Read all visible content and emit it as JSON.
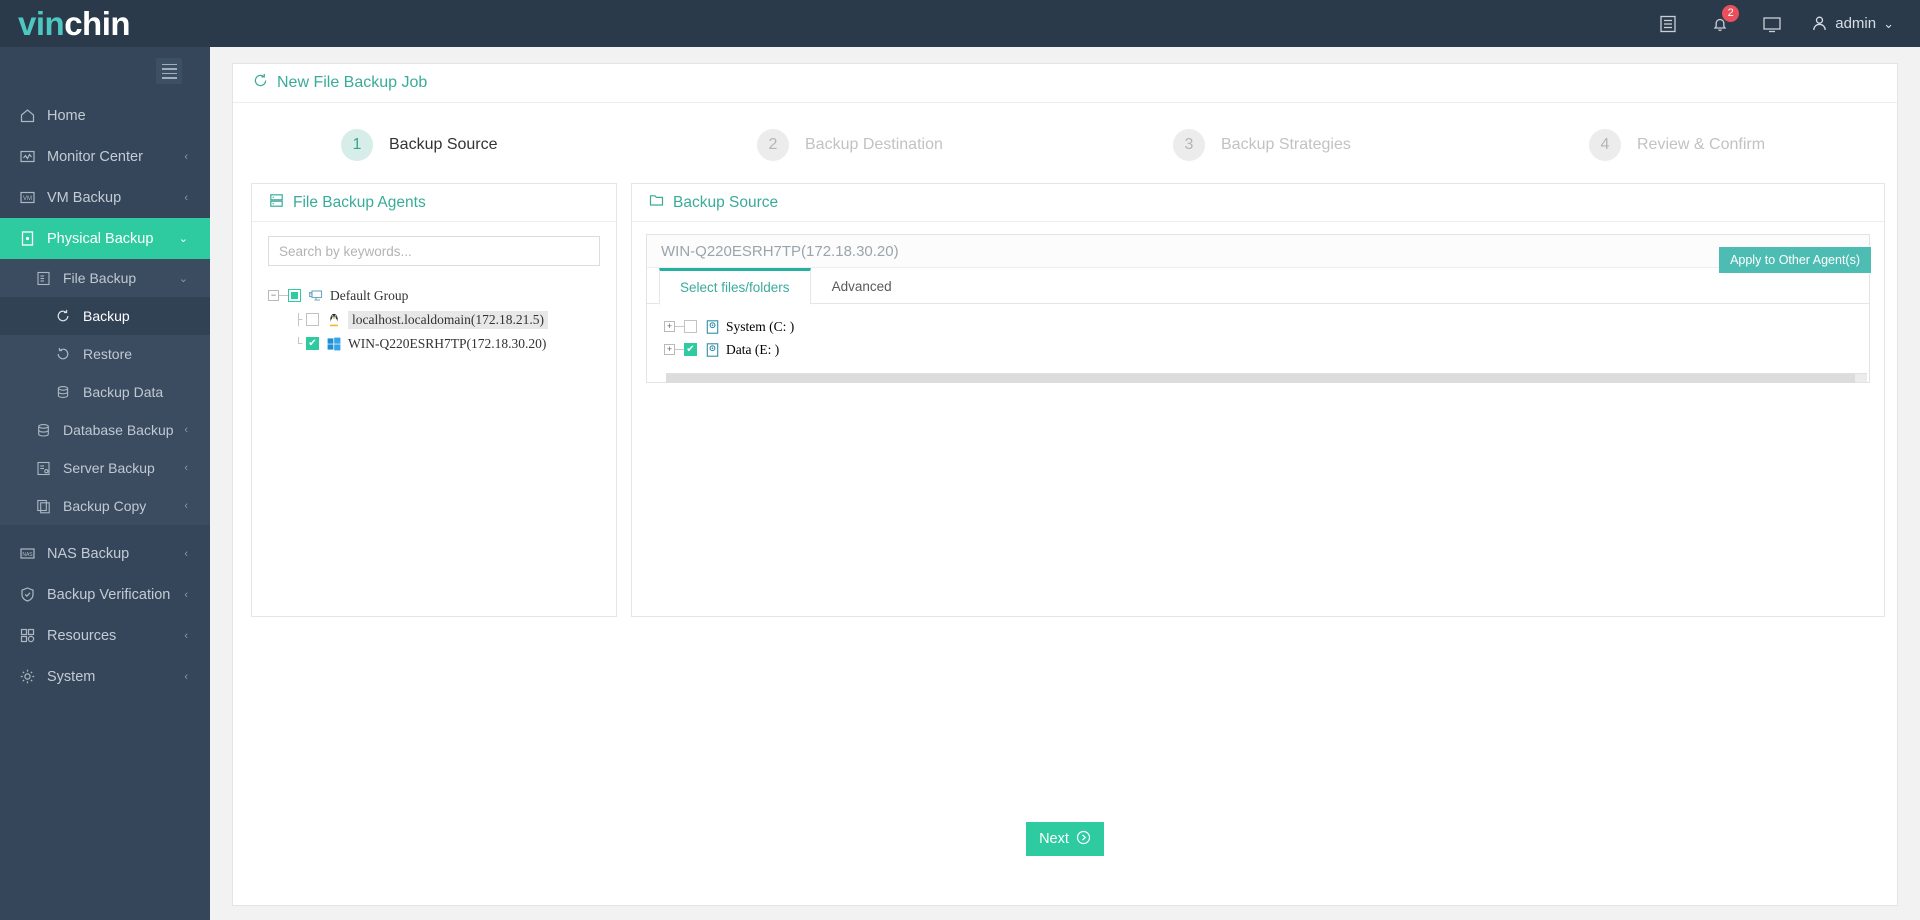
{
  "brand": {
    "part1": "vin",
    "part2": "chin",
    "accent": "#4dc8c0"
  },
  "topbar": {
    "icons": [
      {
        "name": "logs-icon",
        "glyph": "list"
      },
      {
        "name": "notifications-icon",
        "glyph": "bell",
        "badge": "2"
      },
      {
        "name": "console-icon",
        "glyph": "monitor"
      }
    ],
    "user": {
      "label": "admin",
      "caret": "⌄"
    }
  },
  "sidebar": {
    "toggle": "menu-toggle",
    "items": [
      {
        "label": "Home",
        "icon": "home-icon",
        "chevron": "",
        "active": false
      },
      {
        "label": "Monitor Center",
        "icon": "monitor-icon",
        "chevron": "‹",
        "active": false
      },
      {
        "label": "VM Backup",
        "icon": "vm-icon",
        "chevron": "‹",
        "active": false
      },
      {
        "label": "Physical Backup",
        "icon": "server-icon",
        "chevron": "⌄",
        "active": true
      }
    ],
    "sub_items": [
      {
        "label": "File Backup",
        "icon": "file-backup-icon",
        "chevron": "⌄",
        "level": 1,
        "selected": false
      },
      {
        "label": "Backup",
        "icon": "backup-icon",
        "chevron": "",
        "level": 2,
        "selected": true
      },
      {
        "label": "Restore",
        "icon": "restore-icon",
        "chevron": "",
        "level": 2,
        "selected": false
      },
      {
        "label": "Backup Data",
        "icon": "database-icon",
        "chevron": "",
        "level": 2,
        "selected": false
      },
      {
        "label": "Database Backup",
        "icon": "database-icon",
        "chevron": "‹",
        "level": 1,
        "selected": false
      },
      {
        "label": "Server Backup",
        "icon": "server-backup-icon",
        "chevron": "‹",
        "level": 1,
        "selected": false
      },
      {
        "label": "Backup Copy",
        "icon": "copy-icon",
        "chevron": "‹",
        "level": 1,
        "selected": false
      }
    ],
    "items_bottom": [
      {
        "label": "NAS Backup",
        "icon": "nas-icon",
        "chevron": "‹"
      },
      {
        "label": "Backup Verification",
        "icon": "shield-check-icon",
        "chevron": "‹"
      },
      {
        "label": "Resources",
        "icon": "resources-icon",
        "chevron": "‹"
      },
      {
        "label": "System",
        "icon": "gear-icon",
        "chevron": "‹"
      }
    ]
  },
  "page": {
    "title": "New File Backup Job",
    "title_icon": "refresh-icon"
  },
  "stepper": {
    "steps": [
      {
        "num": "1",
        "label": "Backup Source",
        "active": true
      },
      {
        "num": "2",
        "label": "Backup Destination",
        "active": false
      },
      {
        "num": "3",
        "label": "Backup Strategies",
        "active": false
      },
      {
        "num": "4",
        "label": "Review & Confirm",
        "active": false
      }
    ]
  },
  "agents_panel": {
    "title": "File Backup Agents",
    "title_icon": "agents-icon",
    "search_placeholder": "Search by keywords...",
    "search_value": "",
    "tree": {
      "group": {
        "label": "Default Group",
        "expander": "−",
        "checkbox": "partial",
        "icon": "group-icon"
      },
      "children": [
        {
          "label": "localhost.localdomain(172.18.21.5)",
          "checkbox": "unchecked",
          "icon": "linux-icon",
          "highlighted": true
        },
        {
          "label": "WIN-Q220ESRH7TP(172.18.30.20)",
          "checkbox": "checked",
          "icon": "windows-icon",
          "highlighted": false
        }
      ]
    }
  },
  "source_panel": {
    "title": "Backup Source",
    "title_icon": "folder-icon",
    "agent_card": {
      "header": "WIN-Q220ESRH7TP(172.18.30.20)",
      "minimize": "—",
      "apply_button": "Apply to Other Agent(s)",
      "tabs": [
        {
          "label": "Select files/folders",
          "active": true
        },
        {
          "label": "Advanced",
          "active": false
        }
      ],
      "drives": [
        {
          "label": "System (C: )",
          "expander": "+",
          "checkbox": "unchecked",
          "icon": "drive-icon"
        },
        {
          "label": "Data (E: )",
          "expander": "+",
          "checkbox": "checked",
          "icon": "drive-icon"
        }
      ]
    }
  },
  "footer": {
    "next_label": "Next",
    "next_icon": "arrow-right-icon"
  },
  "colors": {
    "accent": "#2ecba0",
    "teal": "#39ab9a",
    "sidebar": "#35465a",
    "topbar": "#2b3a4a",
    "badge": "#e8505b",
    "apply": "#4dbdb4"
  }
}
